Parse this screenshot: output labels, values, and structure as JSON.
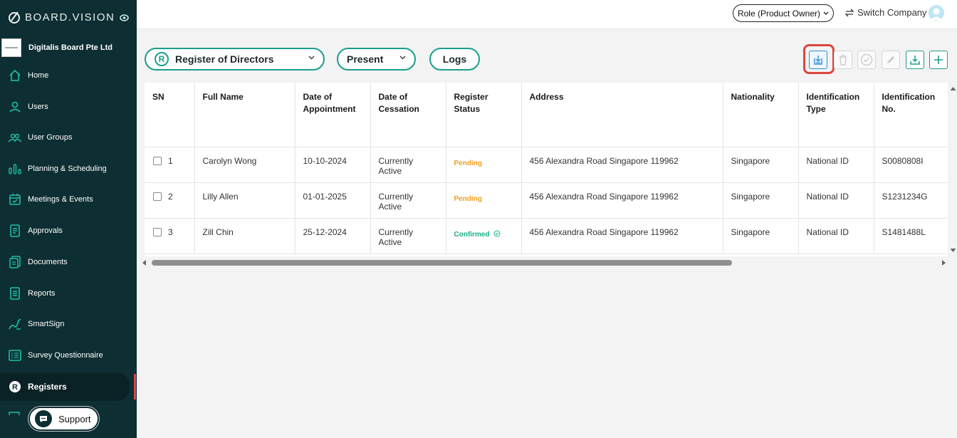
{
  "brand": {
    "name": "BOARD.VISION"
  },
  "company": {
    "name": "Digitalis Board Pte Ltd"
  },
  "nav": [
    {
      "label": "Home",
      "icon": "home-icon"
    },
    {
      "label": "Users",
      "icon": "user-icon"
    },
    {
      "label": "User Groups",
      "icon": "user-group-icon"
    },
    {
      "label": "Planning & Scheduling",
      "icon": "bar-chart-icon"
    },
    {
      "label": "Meetings & Events",
      "icon": "calendar-icon"
    },
    {
      "label": "Approvals",
      "icon": "approval-icon"
    },
    {
      "label": "Documents",
      "icon": "documents-icon"
    },
    {
      "label": "Reports",
      "icon": "reports-icon"
    },
    {
      "label": "SmartSign",
      "icon": "signature-icon"
    },
    {
      "label": "Survey Questionnaire",
      "icon": "survey-icon"
    },
    {
      "label": "Registers",
      "icon": "registers-icon",
      "active": true
    }
  ],
  "support": {
    "label": "Support"
  },
  "topbar": {
    "role_label": "Role (Product Owner)",
    "switch_label": "Switch Company"
  },
  "controls": {
    "register_badge": "R",
    "register_select": "Register of Directors",
    "period_select": "Present",
    "logs_button": "Logs"
  },
  "toolbar": {
    "icons": [
      "import-icon",
      "trash-icon",
      "check-circle-icon",
      "edit-icon",
      "download-icon",
      "plus-icon"
    ],
    "highlighted": "import-icon"
  },
  "colors": {
    "sidebar": "#0d2e33",
    "accent": "#1a9e8c",
    "pending": "#f0a020",
    "confirmed": "#1ab08a",
    "highlight": "#d9473f"
  },
  "table": {
    "headers": [
      "SN",
      "Full Name",
      "Date of Appointment",
      "Date of Cessation",
      "Register Status",
      "Address",
      "Nationality",
      "Identification Type",
      "Identification No."
    ],
    "rows": [
      {
        "sn": "1",
        "name": "Carolyn Wong",
        "appointed": "10-10-2024",
        "cessation": "Currently Active",
        "status": "Pending",
        "address": "456 Alexandra Road Singapore 119962",
        "nationality": "Singapore",
        "id_type": "National ID",
        "id_no": "S0080808I"
      },
      {
        "sn": "2",
        "name": "Lilly Allen",
        "appointed": "01-01-2025",
        "cessation": "Currently Active",
        "status": "Pending",
        "address": "456 Alexandra Road Singapore 119962",
        "nationality": "Singapore",
        "id_type": "National ID",
        "id_no": "S1231234G"
      },
      {
        "sn": "3",
        "name": "Zill Chin",
        "appointed": "25-12-2024",
        "cessation": "Currently Active",
        "status": "Confirmed",
        "address": "456 Alexandra Road Singapore 119962",
        "nationality": "Singapore",
        "id_type": "National ID",
        "id_no": "S1481488L"
      }
    ]
  }
}
